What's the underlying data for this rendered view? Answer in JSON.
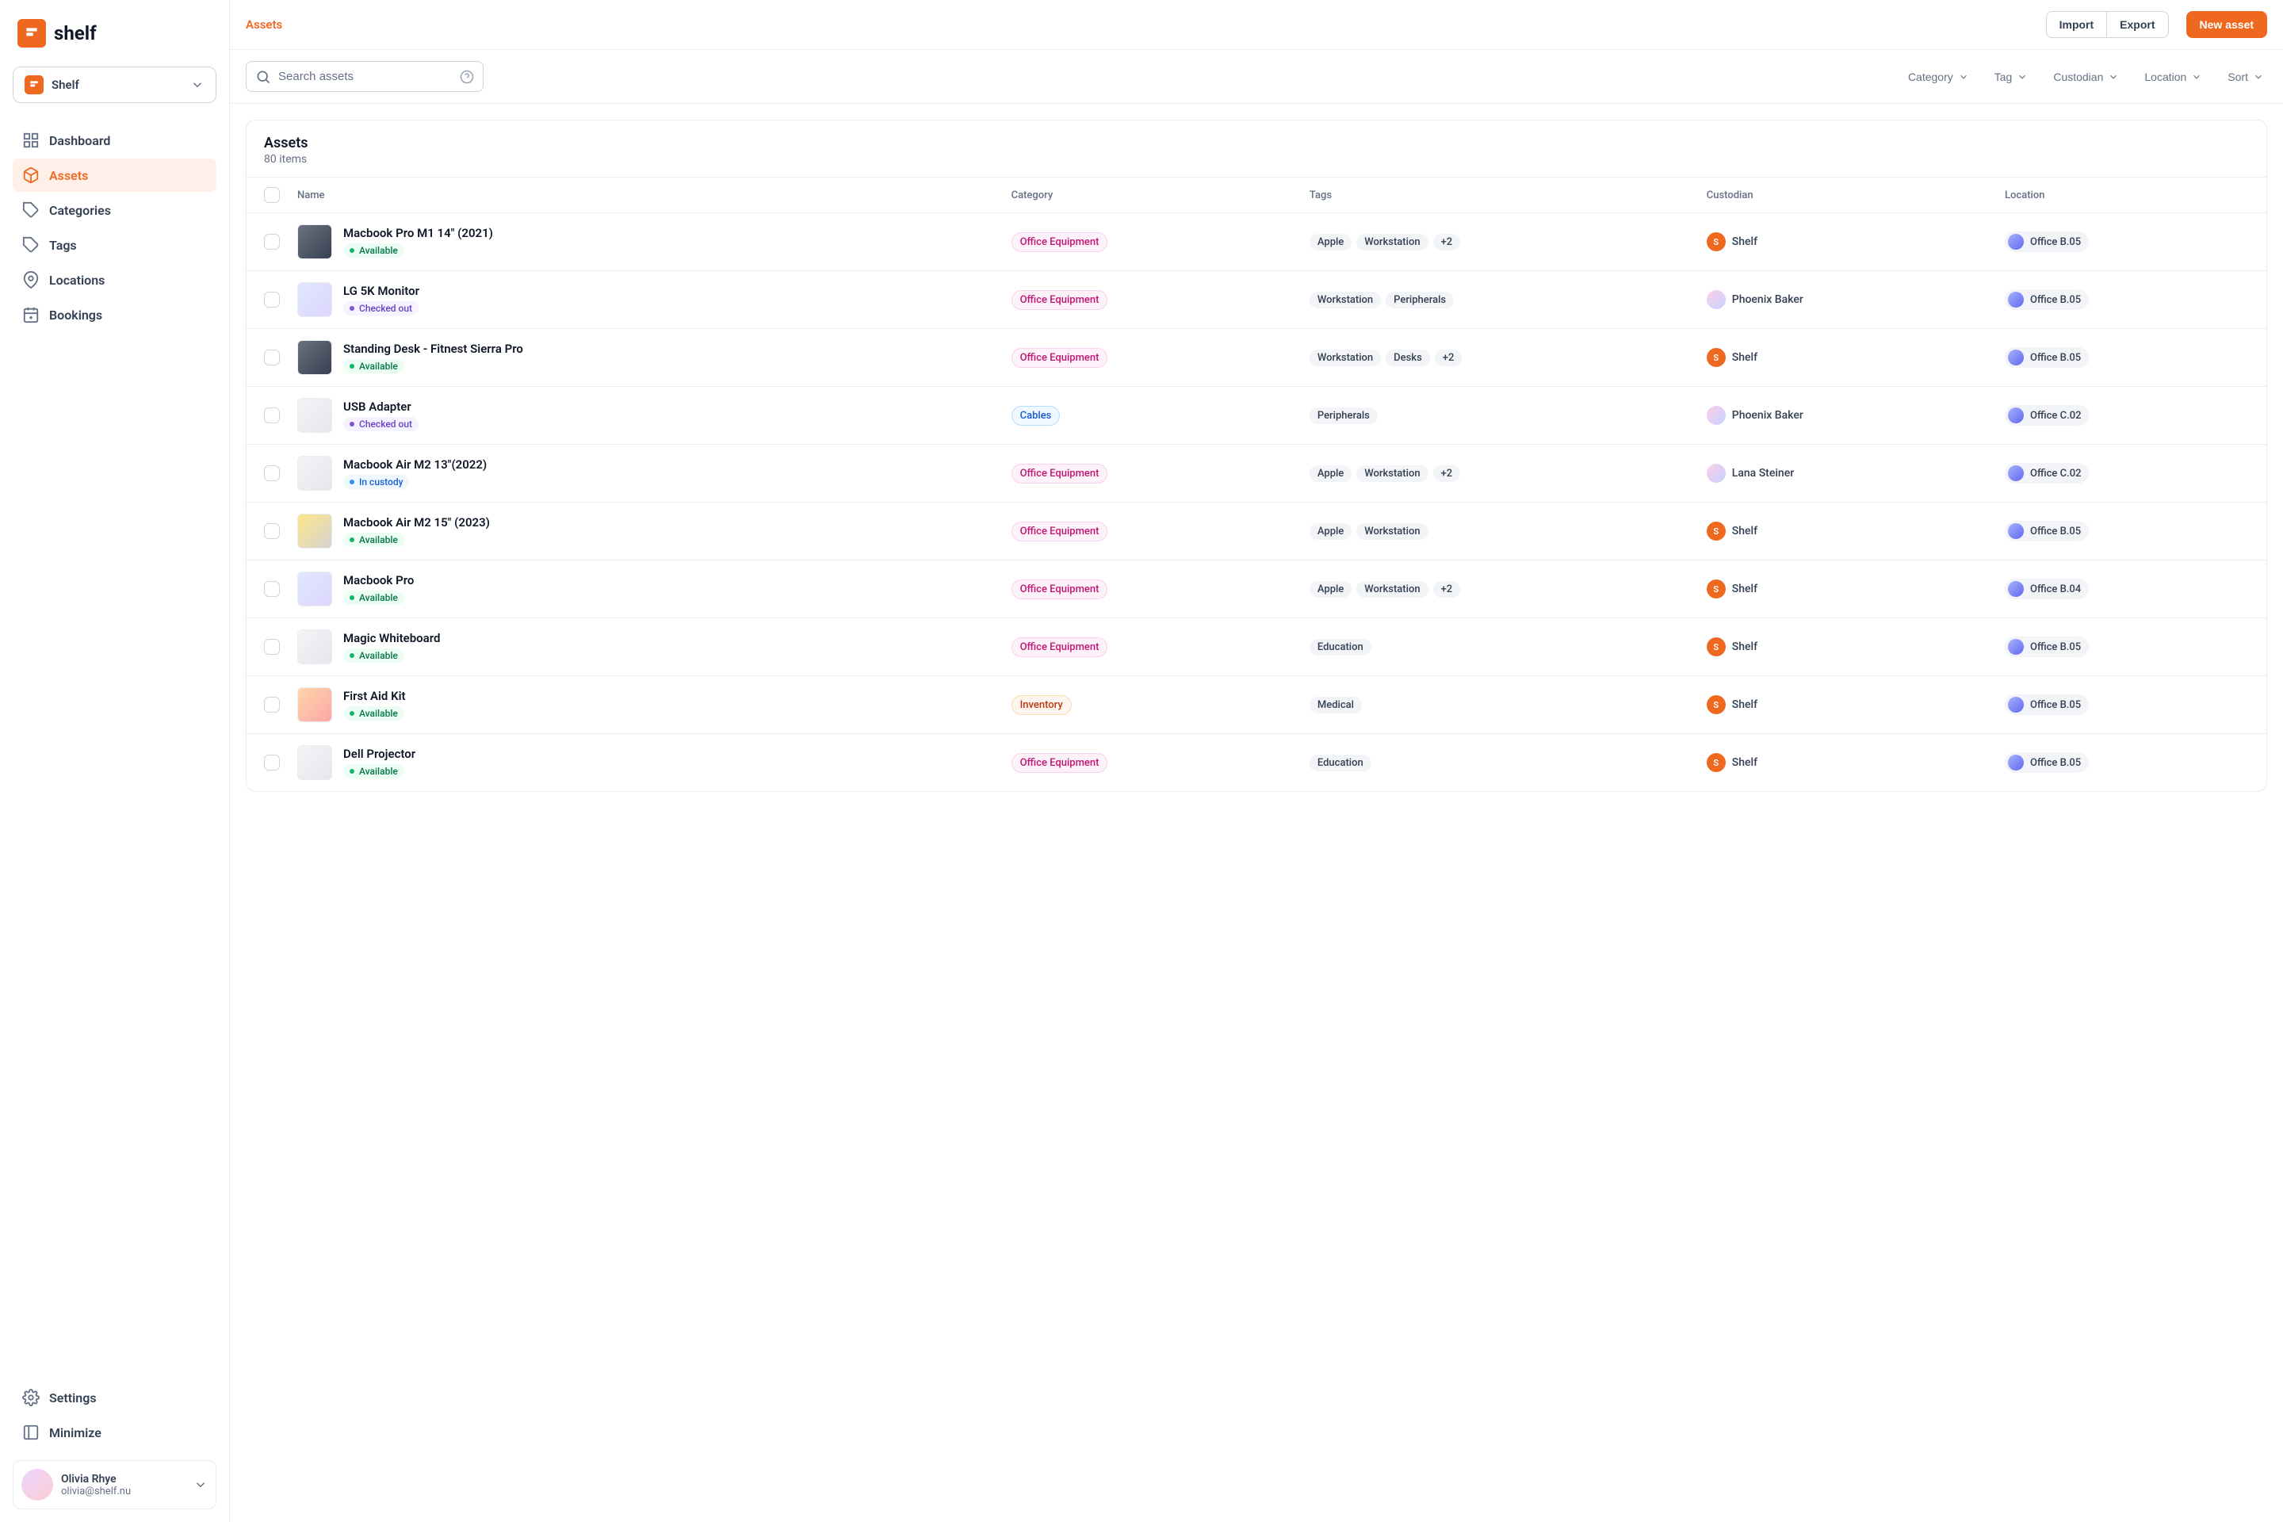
{
  "brand": {
    "name": "shelf"
  },
  "org": {
    "name": "Shelf"
  },
  "sidebar": {
    "items": [
      {
        "key": "dashboard",
        "label": "Dashboard"
      },
      {
        "key": "assets",
        "label": "Assets"
      },
      {
        "key": "categories",
        "label": "Categories"
      },
      {
        "key": "tags",
        "label": "Tags"
      },
      {
        "key": "locations",
        "label": "Locations"
      },
      {
        "key": "bookings",
        "label": "Bookings"
      }
    ],
    "active": "assets",
    "bottom": [
      {
        "key": "settings",
        "label": "Settings"
      },
      {
        "key": "minimize",
        "label": "Minimize"
      }
    ]
  },
  "user": {
    "name": "Olivia Rhye",
    "email": "olivia@shelf.nu"
  },
  "header": {
    "title": "Assets",
    "import": "Import",
    "export": "Export",
    "new_asset": "New asset"
  },
  "search": {
    "placeholder": "Search assets"
  },
  "filters": [
    {
      "key": "category",
      "label": "Category"
    },
    {
      "key": "tag",
      "label": "Tag"
    },
    {
      "key": "custodian",
      "label": "Custodian"
    },
    {
      "key": "location",
      "label": "Location"
    },
    {
      "key": "sort",
      "label": "Sort"
    }
  ],
  "list": {
    "title": "Assets",
    "count_label": "80 items",
    "columns": {
      "name": "Name",
      "category": "Category",
      "tags": "Tags",
      "custodian": "Custodian",
      "location": "Location"
    },
    "rows": [
      {
        "name": "Macbook Pro M1 14\" (2021)",
        "status": "Available",
        "status_kind": "available",
        "category": "Office Equipment",
        "cat_kind": "office",
        "tags": [
          "Apple",
          "Workstation"
        ],
        "tags_more": "+2",
        "custodian": "Shelf",
        "custodian_kind": "shelf",
        "location": "Office B.05",
        "thumb": "dark"
      },
      {
        "name": "LG 5K Monitor",
        "status": "Checked out",
        "status_kind": "checked-out",
        "category": "Office Equipment",
        "cat_kind": "office",
        "tags": [
          "Workstation",
          "Peripherals"
        ],
        "tags_more": null,
        "custodian": "Phoenix Baker",
        "custodian_kind": "person",
        "location": "Office B.05",
        "thumb": ""
      },
      {
        "name": "Standing Desk - Fitnest Sierra Pro",
        "status": "Available",
        "status_kind": "available",
        "category": "Office Equipment",
        "cat_kind": "office",
        "tags": [
          "Workstation",
          "Desks"
        ],
        "tags_more": "+2",
        "custodian": "Shelf",
        "custodian_kind": "shelf",
        "location": "Office B.05",
        "thumb": "dark"
      },
      {
        "name": "USB Adapter",
        "status": "Checked out",
        "status_kind": "checked-out",
        "category": "Cables",
        "cat_kind": "cables",
        "tags": [
          "Peripherals"
        ],
        "tags_more": null,
        "custodian": "Phoenix Baker",
        "custodian_kind": "person",
        "location": "Office C.02",
        "thumb": "gray"
      },
      {
        "name": "Macbook Air M2 13\"(2022)",
        "status": "In custody",
        "status_kind": "in-custody",
        "category": "Office Equipment",
        "cat_kind": "office",
        "tags": [
          "Apple",
          "Workstation"
        ],
        "tags_more": "+2",
        "custodian": "Lana Steiner",
        "custodian_kind": "person",
        "location": "Office C.02",
        "thumb": "gray"
      },
      {
        "name": "Macbook Air M2 15\" (2023)",
        "status": "Available",
        "status_kind": "available",
        "category": "Office Equipment",
        "cat_kind": "office",
        "tags": [
          "Apple",
          "Workstation"
        ],
        "tags_more": null,
        "custodian": "Shelf",
        "custodian_kind": "shelf",
        "location": "Office B.05",
        "thumb": "wood"
      },
      {
        "name": "Macbook Pro",
        "status": "Available",
        "status_kind": "available",
        "category": "Office Equipment",
        "cat_kind": "office",
        "tags": [
          "Apple",
          "Workstation"
        ],
        "tags_more": "+2",
        "custodian": "Shelf",
        "custodian_kind": "shelf",
        "location": "Office B.04",
        "thumb": ""
      },
      {
        "name": "Magic Whiteboard",
        "status": "Available",
        "status_kind": "available",
        "category": "Office Equipment",
        "cat_kind": "office",
        "tags": [
          "Education"
        ],
        "tags_more": null,
        "custodian": "Shelf",
        "custodian_kind": "shelf",
        "location": "Office B.05",
        "thumb": "gray"
      },
      {
        "name": "First Aid Kit",
        "status": "Available",
        "status_kind": "available",
        "category": "Inventory",
        "cat_kind": "inventory",
        "tags": [
          "Medical"
        ],
        "tags_more": null,
        "custodian": "Shelf",
        "custodian_kind": "shelf",
        "location": "Office B.05",
        "thumb": "red"
      },
      {
        "name": "Dell Projector",
        "status": "Available",
        "status_kind": "available",
        "category": "Office Equipment",
        "cat_kind": "office",
        "tags": [
          "Education"
        ],
        "tags_more": null,
        "custodian": "Shelf",
        "custodian_kind": "shelf",
        "location": "Office B.05",
        "thumb": "gray"
      }
    ]
  }
}
